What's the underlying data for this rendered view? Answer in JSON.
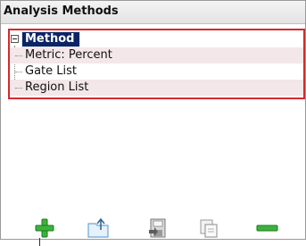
{
  "panel": {
    "title": "Analysis Methods"
  },
  "tree": {
    "root": {
      "label": "Method",
      "expanded": true,
      "selected": true
    },
    "children": [
      {
        "label": "Metric: Percent"
      },
      {
        "label": "Gate List"
      },
      {
        "label": "Region List"
      }
    ]
  },
  "toolbar": {
    "buttons": [
      {
        "icon": "add-icon",
        "color": "#3bb33b"
      },
      {
        "icon": "folder-up-icon",
        "color": "#6ca6d6"
      },
      {
        "icon": "save-icon",
        "color": "#7a7a7a"
      },
      {
        "icon": "copy-icon",
        "color": "#9a9a9a"
      },
      {
        "icon": "remove-icon",
        "color": "#3bb33b"
      }
    ]
  },
  "colors": {
    "selection": "#0a2464",
    "tree_border": "#d42a2a",
    "alt_row": "#f3e7ea"
  }
}
